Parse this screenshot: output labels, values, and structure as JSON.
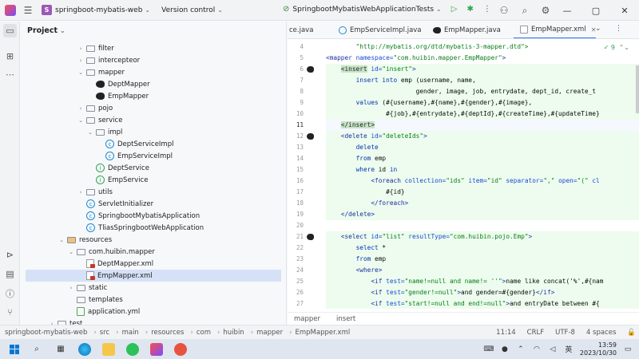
{
  "titlebar": {
    "project_badge": "S",
    "project_name": "springboot-mybatis-web",
    "vcs": "Version control",
    "run_config": "SpringbootMybatisWebApplicationTests"
  },
  "project_panel": {
    "title": "Project",
    "nodes": [
      {
        "label": "filter",
        "type": "folder",
        "indent": 3,
        "arrow": "›"
      },
      {
        "label": "intercepteor",
        "type": "folder",
        "indent": 3,
        "arrow": "›"
      },
      {
        "label": "mapper",
        "type": "folder",
        "indent": 3,
        "arrow": "⌄"
      },
      {
        "label": "DeptMapper",
        "type": "bird",
        "indent": 4,
        "arrow": ""
      },
      {
        "label": "EmpMapper",
        "type": "bird",
        "indent": 4,
        "arrow": ""
      },
      {
        "label": "pojo",
        "type": "folder",
        "indent": 3,
        "arrow": "›"
      },
      {
        "label": "service",
        "type": "folder",
        "indent": 3,
        "arrow": "⌄"
      },
      {
        "label": "impl",
        "type": "folder",
        "indent": 4,
        "arrow": "⌄"
      },
      {
        "label": "DeptServiceImpl",
        "type": "class",
        "indent": 5,
        "arrow": ""
      },
      {
        "label": "EmpServiceImpl",
        "type": "class",
        "indent": 5,
        "arrow": ""
      },
      {
        "label": "DeptService",
        "type": "interface",
        "indent": 4,
        "arrow": ""
      },
      {
        "label": "EmpService",
        "type": "interface",
        "indent": 4,
        "arrow": ""
      },
      {
        "label": "utils",
        "type": "folder",
        "indent": 3,
        "arrow": "›"
      },
      {
        "label": "ServletInitializer",
        "type": "class",
        "indent": 3,
        "arrow": ""
      },
      {
        "label": "SpringbootMybatisApplication",
        "type": "class",
        "indent": 3,
        "arrow": ""
      },
      {
        "label": "TliasSpringbootWebApplication",
        "type": "class",
        "indent": 3,
        "arrow": ""
      },
      {
        "label": "resources",
        "type": "resfolder",
        "indent": 1,
        "arrow": "⌄"
      },
      {
        "label": "com.huibin.mapper",
        "type": "folder",
        "indent": 2,
        "arrow": "⌄"
      },
      {
        "label": "DeptMapper.xml",
        "type": "xml",
        "indent": 3,
        "arrow": ""
      },
      {
        "label": "EmpMapper.xml",
        "type": "xml",
        "indent": 3,
        "arrow": "",
        "selected": true
      },
      {
        "label": "static",
        "type": "folder",
        "indent": 2,
        "arrow": "›"
      },
      {
        "label": "templates",
        "type": "folder",
        "indent": 2,
        "arrow": ""
      },
      {
        "label": "application.yml",
        "type": "yml",
        "indent": 2,
        "arrow": ""
      },
      {
        "label": "test",
        "type": "folder",
        "indent": 0,
        "arrow": "›"
      }
    ]
  },
  "editor": {
    "tabs": [
      {
        "label": "ce.java",
        "icon": "class",
        "active": false
      },
      {
        "label": "EmpServiceImpl.java",
        "icon": "class",
        "active": false
      },
      {
        "label": "EmpMapper.java",
        "icon": "bird",
        "active": false
      },
      {
        "label": "EmpMapper.xml",
        "icon": "xml",
        "active": true
      }
    ],
    "inspection_count": "9",
    "lines": [
      {
        "n": "4",
        "parts": [
          [
            "str",
            "        \"http://mybatis.org/dtd/mybatis-3-mapper.dtd\">"
          ]
        ]
      },
      {
        "n": "5",
        "parts": [
          [
            "tag",
            "<mapper "
          ],
          [
            "attr",
            "namespace="
          ],
          [
            "str",
            "\"com.huibin.mapper.EmpMapper\""
          ],
          [
            "tag",
            ">"
          ]
        ]
      },
      {
        "n": "6",
        "gicon": true,
        "hl": true,
        "parts": [
          [
            "plain",
            "    "
          ],
          [
            "tagbox",
            "<insert"
          ],
          [
            "attr",
            " id="
          ],
          [
            "str",
            "\"insert\""
          ],
          [
            "tag",
            ">"
          ]
        ]
      },
      {
        "n": "7",
        "hl": true,
        "parts": [
          [
            "plain",
            "        "
          ],
          [
            "kw",
            "insert into "
          ],
          [
            "plain",
            "emp (username, name,"
          ]
        ]
      },
      {
        "n": "8",
        "hl": true,
        "parts": [
          [
            "plain",
            "                        gender, image, job, entrydate, dept_id, create_t"
          ]
        ]
      },
      {
        "n": "9",
        "hl": true,
        "parts": [
          [
            "plain",
            "        "
          ],
          [
            "kw",
            "values "
          ],
          [
            "plain",
            "(#{username},#{name},#{gender},#{image},"
          ]
        ]
      },
      {
        "n": "10",
        "hl": true,
        "parts": [
          [
            "plain",
            "                #{job},#{entrydate},#{deptId},#{createTime},#{updateTime}"
          ]
        ]
      },
      {
        "n": "11",
        "cur": true,
        "parts": [
          [
            "plain",
            "    "
          ],
          [
            "tagbox",
            "</insert>"
          ]
        ]
      },
      {
        "n": "12",
        "gicon": true,
        "hl": true,
        "parts": [
          [
            "plain",
            "    "
          ],
          [
            "tag",
            "<delete "
          ],
          [
            "attr",
            "id="
          ],
          [
            "str",
            "\"deleteIds\""
          ],
          [
            "tag",
            ">"
          ]
        ]
      },
      {
        "n": "13",
        "hl": true,
        "parts": [
          [
            "plain",
            "        "
          ],
          [
            "kw",
            "delete"
          ]
        ]
      },
      {
        "n": "14",
        "hl": true,
        "parts": [
          [
            "plain",
            "        "
          ],
          [
            "kw",
            "from "
          ],
          [
            "plain",
            "emp"
          ]
        ]
      },
      {
        "n": "15",
        "hl": true,
        "parts": [
          [
            "plain",
            "        "
          ],
          [
            "kw",
            "where "
          ],
          [
            "plain",
            "id "
          ],
          [
            "kw",
            "in"
          ]
        ]
      },
      {
        "n": "16",
        "hl": true,
        "parts": [
          [
            "plain",
            "            "
          ],
          [
            "tag",
            "<foreach "
          ],
          [
            "attr",
            "collection="
          ],
          [
            "str",
            "\"ids\""
          ],
          [
            "attr",
            " item="
          ],
          [
            "str",
            "\"id\""
          ],
          [
            "attr",
            " separator="
          ],
          [
            "str",
            "\",\""
          ],
          [
            "attr",
            " open="
          ],
          [
            "str",
            "\"(\""
          ],
          [
            "attr",
            " cl"
          ]
        ]
      },
      {
        "n": "17",
        "hl": true,
        "parts": [
          [
            "plain",
            "                #{id}"
          ]
        ]
      },
      {
        "n": "18",
        "hl": true,
        "parts": [
          [
            "plain",
            "            "
          ],
          [
            "tag",
            "</foreach>"
          ]
        ]
      },
      {
        "n": "19",
        "hl": true,
        "parts": [
          [
            "plain",
            "    "
          ],
          [
            "tag",
            "</delete>"
          ]
        ]
      },
      {
        "n": "20",
        "parts": [
          [
            "plain",
            ""
          ]
        ]
      },
      {
        "n": "21",
        "gicon": true,
        "hl": true,
        "parts": [
          [
            "plain",
            "    "
          ],
          [
            "tag",
            "<select "
          ],
          [
            "attr",
            "id="
          ],
          [
            "str",
            "\"list\""
          ],
          [
            "attr",
            " resultType="
          ],
          [
            "str",
            "\"com.huibin.pojo.Emp\""
          ],
          [
            "tag",
            ">"
          ]
        ]
      },
      {
        "n": "22",
        "hl": true,
        "parts": [
          [
            "plain",
            "        "
          ],
          [
            "kw",
            "select "
          ],
          [
            "plain",
            "*"
          ]
        ]
      },
      {
        "n": "23",
        "hl": true,
        "parts": [
          [
            "plain",
            "        "
          ],
          [
            "kw",
            "from "
          ],
          [
            "plain",
            "emp"
          ]
        ]
      },
      {
        "n": "24",
        "hl": true,
        "parts": [
          [
            "plain",
            "        "
          ],
          [
            "tag",
            "<where>"
          ]
        ]
      },
      {
        "n": "25",
        "hl": true,
        "parts": [
          [
            "plain",
            "            "
          ],
          [
            "tag",
            "<if "
          ],
          [
            "attr",
            "test="
          ],
          [
            "str",
            "\"name!=null and name!= ''\""
          ],
          [
            "tag",
            ">"
          ],
          [
            "plain",
            "name like concat('%',#{nam"
          ]
        ]
      },
      {
        "n": "26",
        "hl": true,
        "parts": [
          [
            "plain",
            "            "
          ],
          [
            "tag",
            "<if "
          ],
          [
            "attr",
            "test="
          ],
          [
            "str",
            "\"gender!=null\""
          ],
          [
            "tag",
            ">"
          ],
          [
            "plain",
            "and gender=#{gender}"
          ],
          [
            "tag",
            "</if>"
          ]
        ]
      },
      {
        "n": "27",
        "hl": true,
        "parts": [
          [
            "plain",
            "            "
          ],
          [
            "tag",
            "<if "
          ],
          [
            "attr",
            "test="
          ],
          [
            "str",
            "\"start!=null and end!=null\""
          ],
          [
            "tag",
            ">"
          ],
          [
            "plain",
            "and entryDate between #{"
          ]
        ]
      },
      {
        "n": "28",
        "hl": true,
        "parts": [
          [
            "plain",
            "        "
          ],
          [
            "tag",
            "</where>"
          ]
        ]
      }
    ],
    "breadcrumb": [
      "mapper",
      "insert"
    ]
  },
  "statusbar": {
    "path": [
      "springboot-mybatis-web",
      "src",
      "main",
      "resources",
      "com",
      "huibin",
      "mapper",
      "EmpMapper.xml"
    ],
    "position": "11:14",
    "line_sep": "CRLF",
    "encoding": "UTF-8",
    "indent": "4 spaces"
  },
  "taskbar": {
    "time": "13:59",
    "date": "2023/10/30",
    "lang": "英"
  }
}
